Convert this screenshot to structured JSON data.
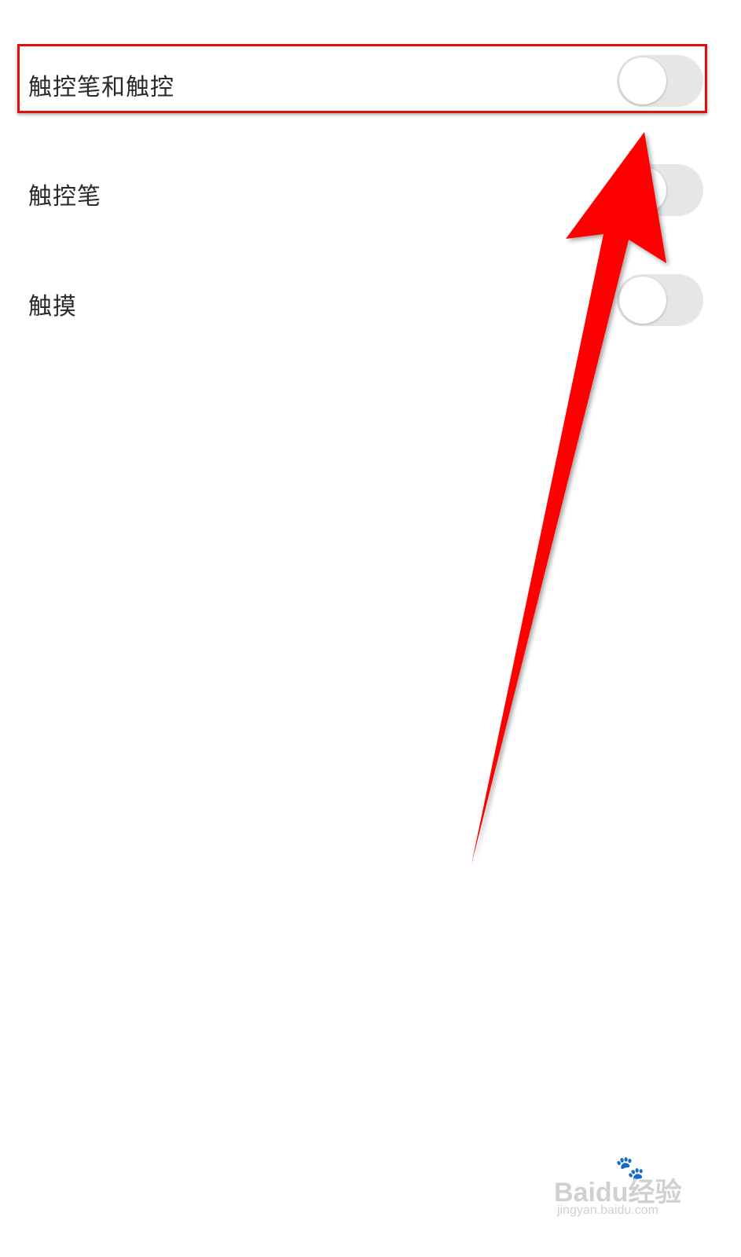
{
  "settings": {
    "items": [
      {
        "label": "触控笔和触控",
        "enabled": false,
        "highlighted": true
      },
      {
        "label": "触控笔",
        "enabled": false,
        "highlighted": false
      },
      {
        "label": "触摸",
        "enabled": false,
        "highlighted": false
      }
    ]
  },
  "annotation": {
    "box_color": "#e01010",
    "arrow_color": "#ff0000"
  },
  "watermark": {
    "brand": "Baidu经验",
    "url": "jingyan.baidu.com"
  }
}
